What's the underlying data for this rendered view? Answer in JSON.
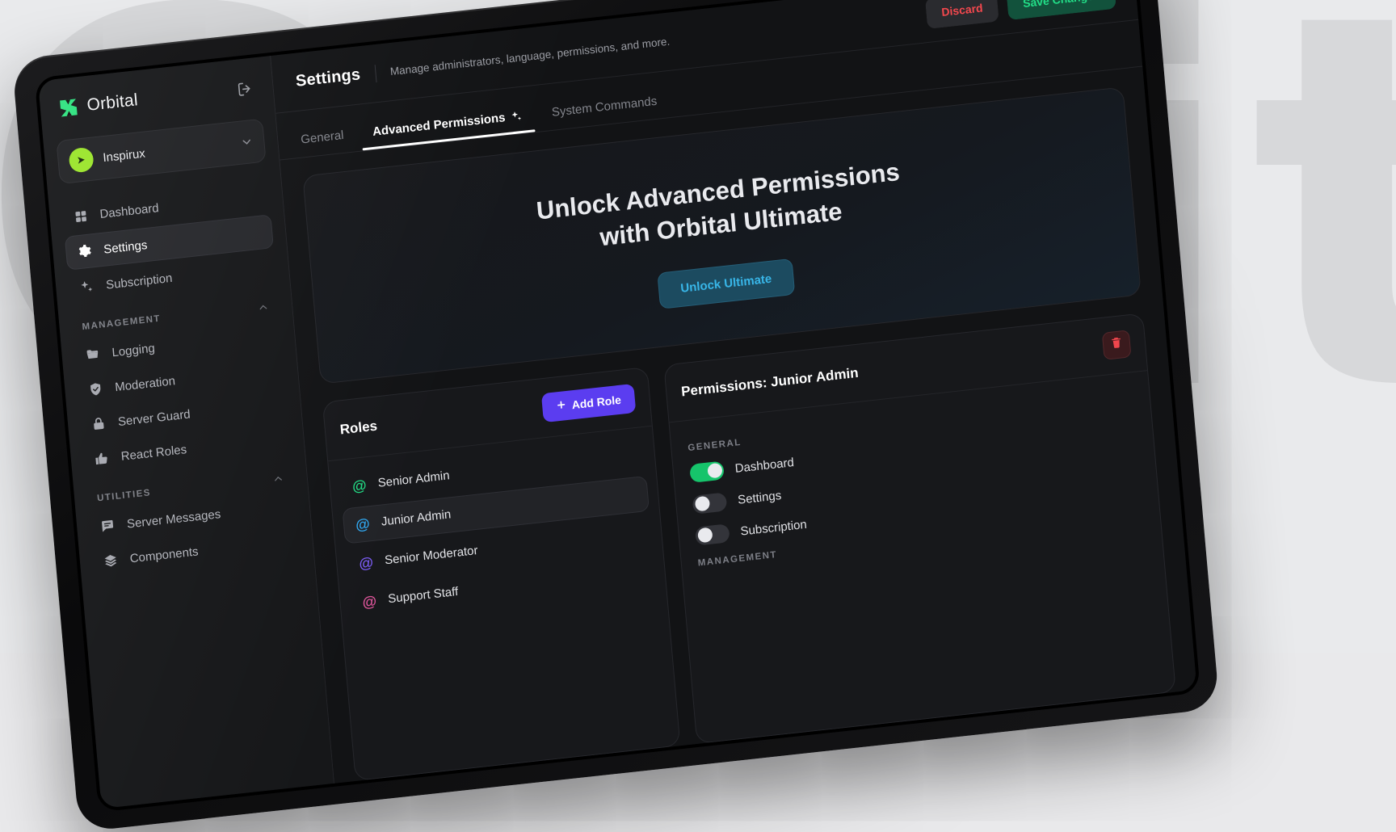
{
  "background": {
    "letters": "Orbital"
  },
  "sidebar": {
    "brand": {
      "name": "Orbital",
      "logo_colors": [
        "#29e07a",
        "#13c06a"
      ]
    },
    "logout_icon": "logout-icon",
    "server": {
      "name": "Inspirux",
      "avatar_color": "#9ae52a",
      "chevron": "chevron-down-icon"
    },
    "items": [
      {
        "label": "Dashboard",
        "icon": "grid-icon",
        "active": false
      },
      {
        "label": "Settings",
        "icon": "gear-icon",
        "active": true
      },
      {
        "label": "Subscription",
        "icon": "sparkles-icon",
        "active": false
      }
    ],
    "groups": [
      {
        "label": "MANAGEMENT",
        "collapse_icon": "chevron-up-icon",
        "items": [
          {
            "label": "Logging",
            "icon": "folder-icon"
          },
          {
            "label": "Moderation",
            "icon": "shield-check-icon"
          },
          {
            "label": "Server Guard",
            "icon": "lock-icon"
          },
          {
            "label": "React Roles",
            "icon": "thumbs-up-icon"
          }
        ]
      },
      {
        "label": "UTILITIES",
        "collapse_icon": "chevron-up-icon",
        "items": [
          {
            "label": "Server Messages",
            "icon": "chat-icon"
          },
          {
            "label": "Components",
            "icon": "layers-icon"
          }
        ]
      }
    ]
  },
  "header": {
    "title": "Settings",
    "subtitle": "Manage administrators, language, permissions, and more.",
    "discard_label": "Discard",
    "save_label": "Save Changes",
    "discard_color": "#f4484e",
    "save_color": "#22dd87"
  },
  "tabs": [
    {
      "label": "General",
      "active": false,
      "badge": ""
    },
    {
      "label": "Advanced Permissions",
      "active": true,
      "badge": "sparkles-icon"
    },
    {
      "label": "System Commands",
      "active": false,
      "badge": ""
    }
  ],
  "hero": {
    "title_line1": "Unlock Advanced Permissions",
    "title_line2": "with Orbital Ultimate",
    "button_label": "Unlock Ultimate",
    "button_color": "#38b6e8"
  },
  "roles_panel": {
    "title": "Roles",
    "add_label": "Add Role",
    "add_icon": "plus-icon",
    "add_color": "#5b3df0",
    "roles": [
      {
        "name": "Senior Admin",
        "color": "#22d983",
        "selected": false
      },
      {
        "name": "Junior Admin",
        "color": "#2fa7f0",
        "selected": true
      },
      {
        "name": "Senior Moderator",
        "color": "#7b5cf5",
        "selected": false
      },
      {
        "name": "Support Staff",
        "color": "#e0569c",
        "selected": false
      }
    ]
  },
  "permissions_panel": {
    "title": "Permissions: Junior Admin",
    "delete_icon": "trash-icon",
    "groups": [
      {
        "label": "GENERAL",
        "items": [
          {
            "label": "Dashboard",
            "enabled": true
          },
          {
            "label": "Settings",
            "enabled": false
          },
          {
            "label": "Subscription",
            "enabled": false
          }
        ]
      },
      {
        "label": "MANAGEMENT",
        "items": []
      }
    ]
  }
}
